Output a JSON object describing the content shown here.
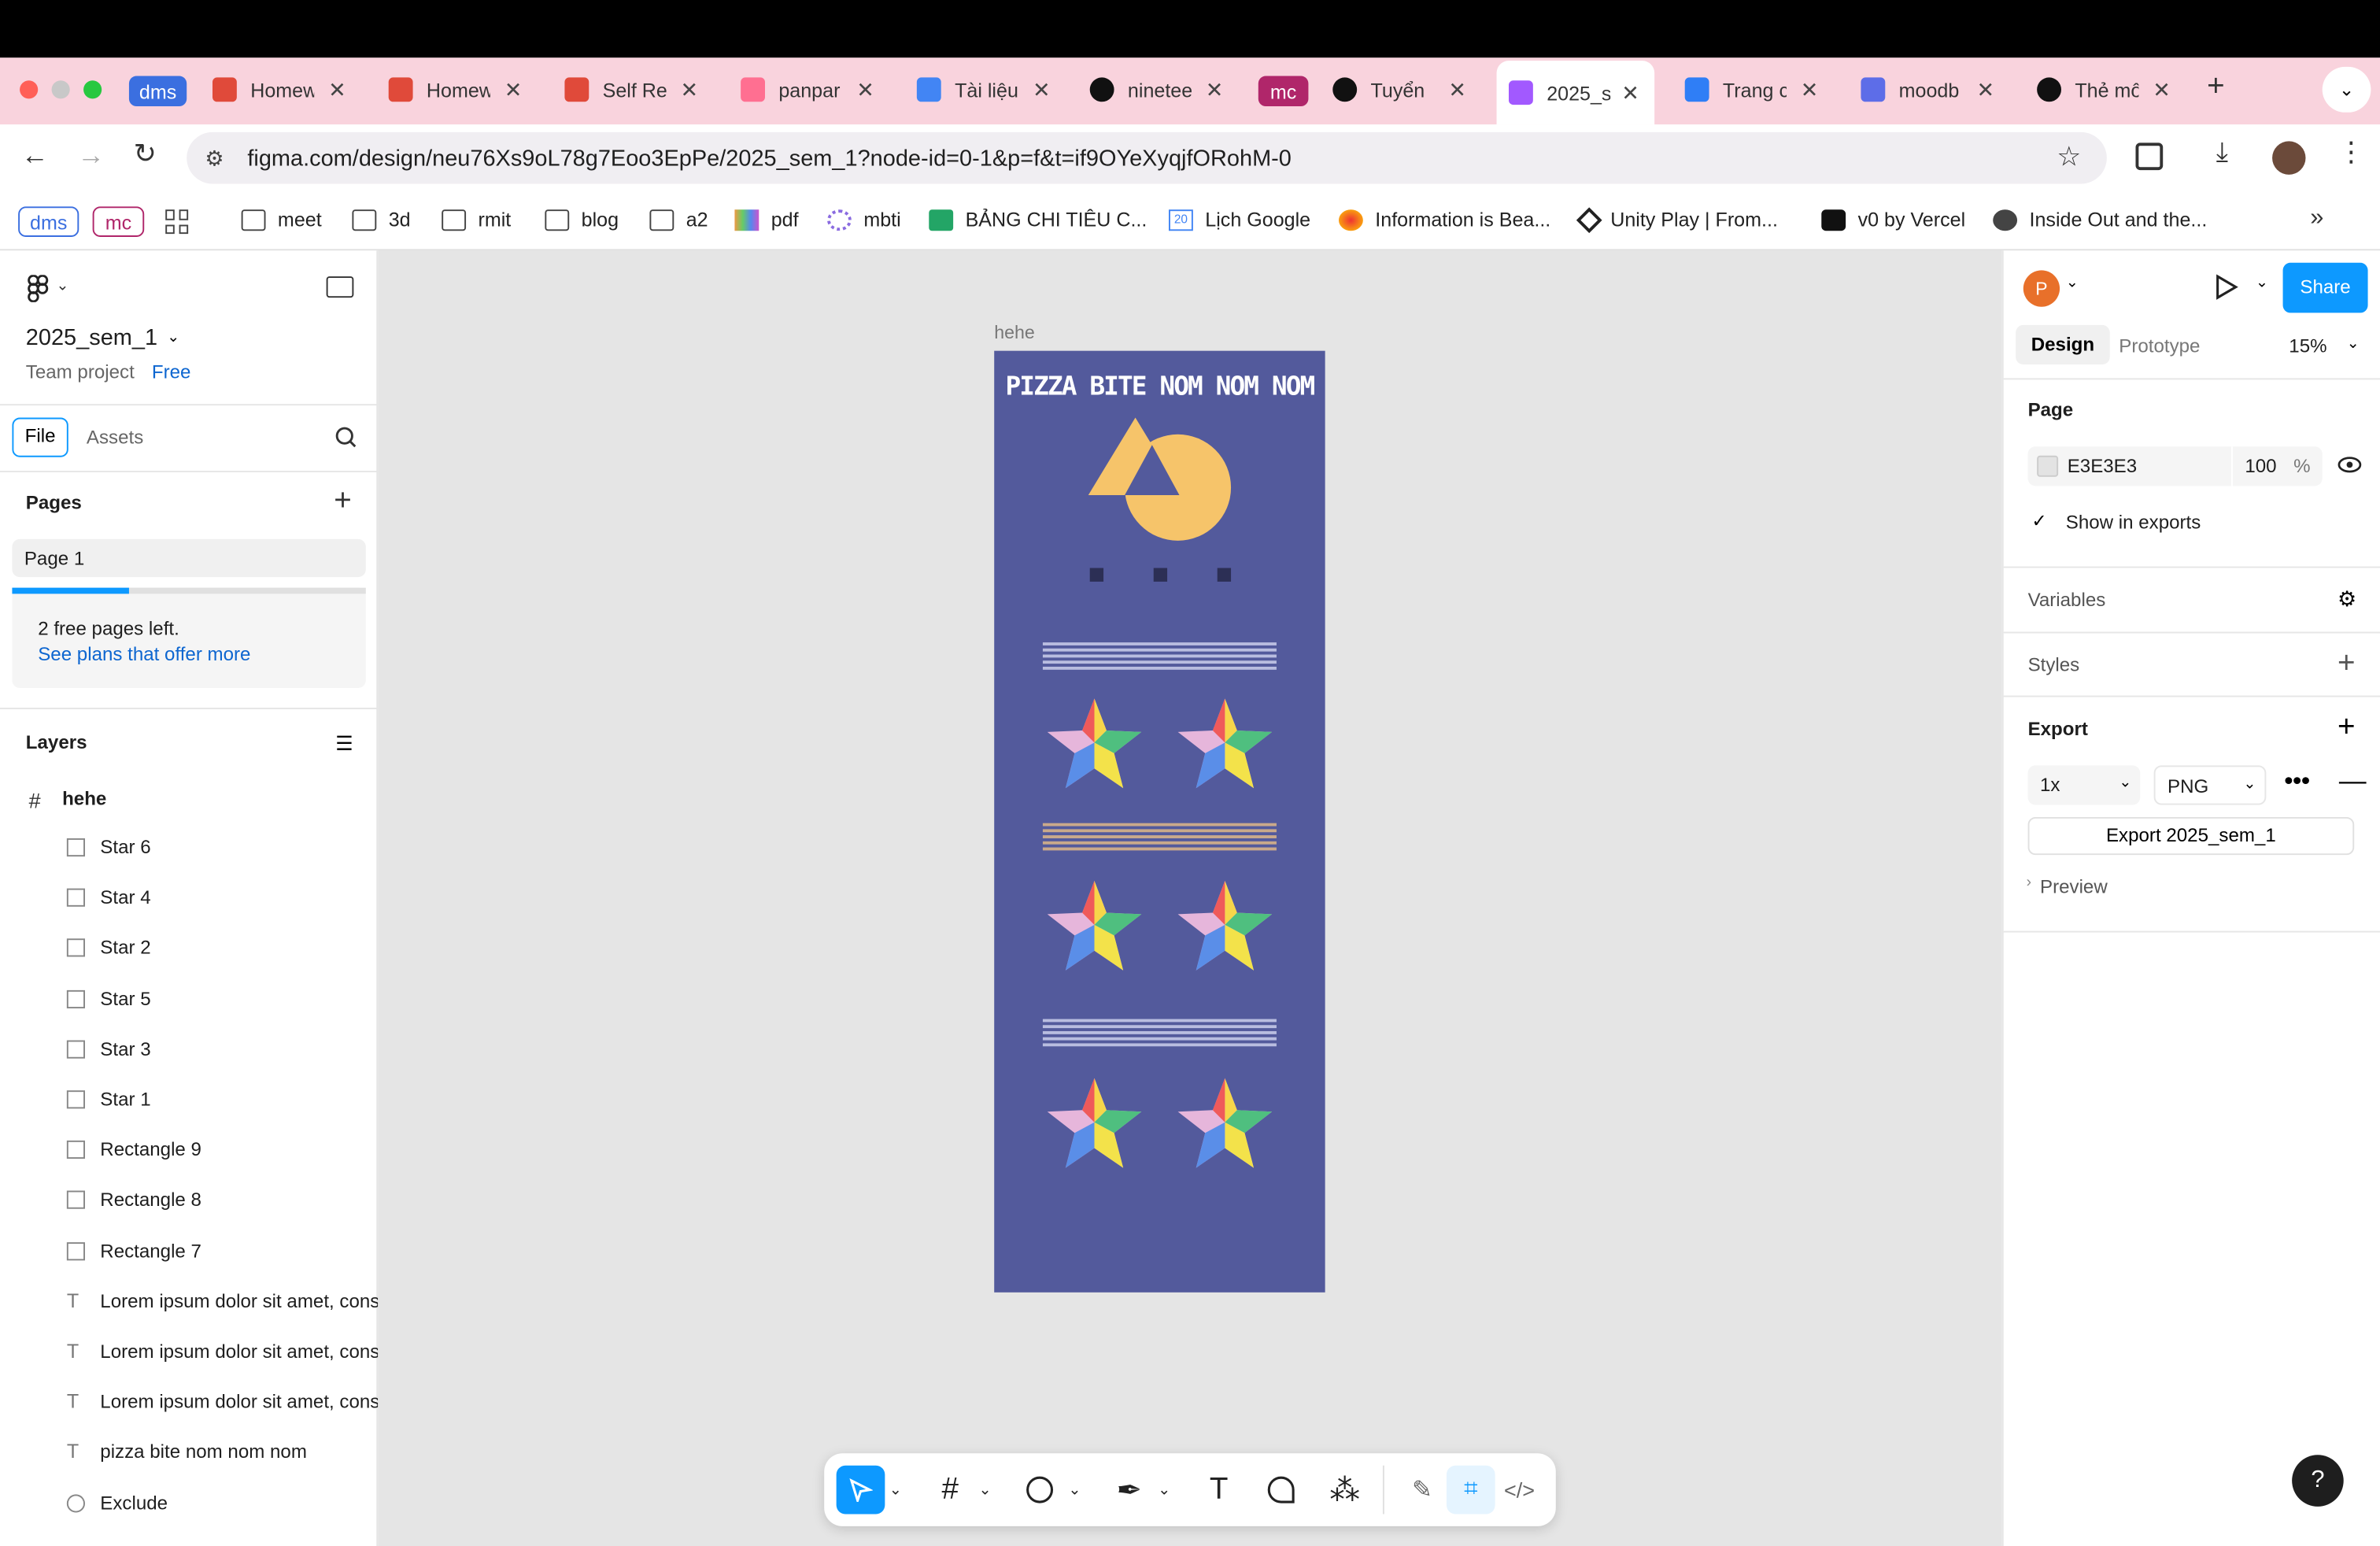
{
  "browser": {
    "tabs": [
      {
        "title": "Homew",
        "icon": "claude-icon",
        "color": "#e04a3a"
      },
      {
        "title": "Homew",
        "icon": "claude-icon",
        "color": "#e04a3a"
      },
      {
        "title": "Self Re",
        "icon": "claude-icon",
        "color": "#e04a3a"
      },
      {
        "title": "panpar",
        "icon": "spiral-icon",
        "color": "#ff6f91"
      },
      {
        "title": "Tài liệu",
        "icon": "docs-icon",
        "color": "#4285f4"
      },
      {
        "title": "ninetee",
        "icon": "github-icon",
        "color": "#111111"
      },
      {
        "title": "Tuyển",
        "icon": "openai-icon",
        "color": "#111111"
      },
      {
        "title": "2025_s",
        "icon": "figma-icon",
        "color": "#a259ff"
      },
      {
        "title": "Trang c",
        "icon": "canva-icon",
        "color": "#2f7ef6"
      },
      {
        "title": "moodb",
        "icon": "moodboard-icon",
        "color": "#5d6de8"
      },
      {
        "title": "Thẻ mô",
        "icon": "openai-icon",
        "color": "#111111"
      }
    ],
    "group_dms": "dms",
    "group_mc": "mc",
    "url": "figma.com/design/neu76Xs9oL78g7Eoo3EpPe/2025_sem_1?node-id=0-1&p=f&t=if9OYeXyqjfORohM-0",
    "bookmarks": {
      "dms": "dms",
      "mc": "mc",
      "items": [
        "meet",
        "3d",
        "rmit",
        "blog",
        "a2",
        "pdf",
        "mbti",
        "BẢNG CHI TIÊU C...",
        "Lịch Google",
        "Information is Bea...",
        "Unity Play | From...",
        "v0 by Vercel",
        "Inside Out and the..."
      ],
      "calendar_day": "20",
      "more": "»"
    }
  },
  "file": {
    "name": "2025_sem_1",
    "team": "Team project",
    "plan": "Free"
  },
  "left_tabs": {
    "file": "File",
    "assets": "Assets"
  },
  "pages": {
    "header": "Pages",
    "items": [
      "Page 1"
    ],
    "banner_text": "2 free pages left.",
    "banner_link": "See plans that offer more",
    "usage_fraction": 0.33
  },
  "layers": {
    "header": "Layers",
    "frame": "hehe",
    "items": [
      {
        "name": "Star 6",
        "type": "image"
      },
      {
        "name": "Star 4",
        "type": "image"
      },
      {
        "name": "Star 2",
        "type": "image"
      },
      {
        "name": "Star 5",
        "type": "image"
      },
      {
        "name": "Star 3",
        "type": "image"
      },
      {
        "name": "Star 1",
        "type": "image"
      },
      {
        "name": "Rectangle 9",
        "type": "rect"
      },
      {
        "name": "Rectangle 8",
        "type": "rect"
      },
      {
        "name": "Rectangle 7",
        "type": "rect"
      },
      {
        "name": "Lorem ipsum dolor sit amet, consectetur",
        "type": "text"
      },
      {
        "name": "Lorem ipsum dolor sit amet, consectetur",
        "type": "text"
      },
      {
        "name": "Lorem ipsum dolor sit amet, consectetur",
        "type": "text"
      },
      {
        "name": "pizza bite nom nom nom",
        "type": "text"
      },
      {
        "name": "Exclude",
        "type": "boolean"
      }
    ]
  },
  "canvas": {
    "frame_label": "hehe",
    "frame_title": "PIZZA BITE NOM NOM NOM",
    "frame_color": "#535a9c",
    "accent": "#f6c46a"
  },
  "right_panel": {
    "avatar_letter": "P",
    "share": "Share",
    "tabs": {
      "design": "Design",
      "prototype": "Prototype"
    },
    "zoom": "15%",
    "page_header": "Page",
    "page_color": "E3E3E3",
    "page_opacity": "100",
    "percent": "%",
    "show_in_exports": "Show in exports",
    "variables": "Variables",
    "styles": "Styles",
    "export_header": "Export",
    "export_scale": "1x",
    "export_format": "PNG",
    "export_button": "Export 2025_sem_1",
    "preview": "Preview",
    "help": "?"
  }
}
